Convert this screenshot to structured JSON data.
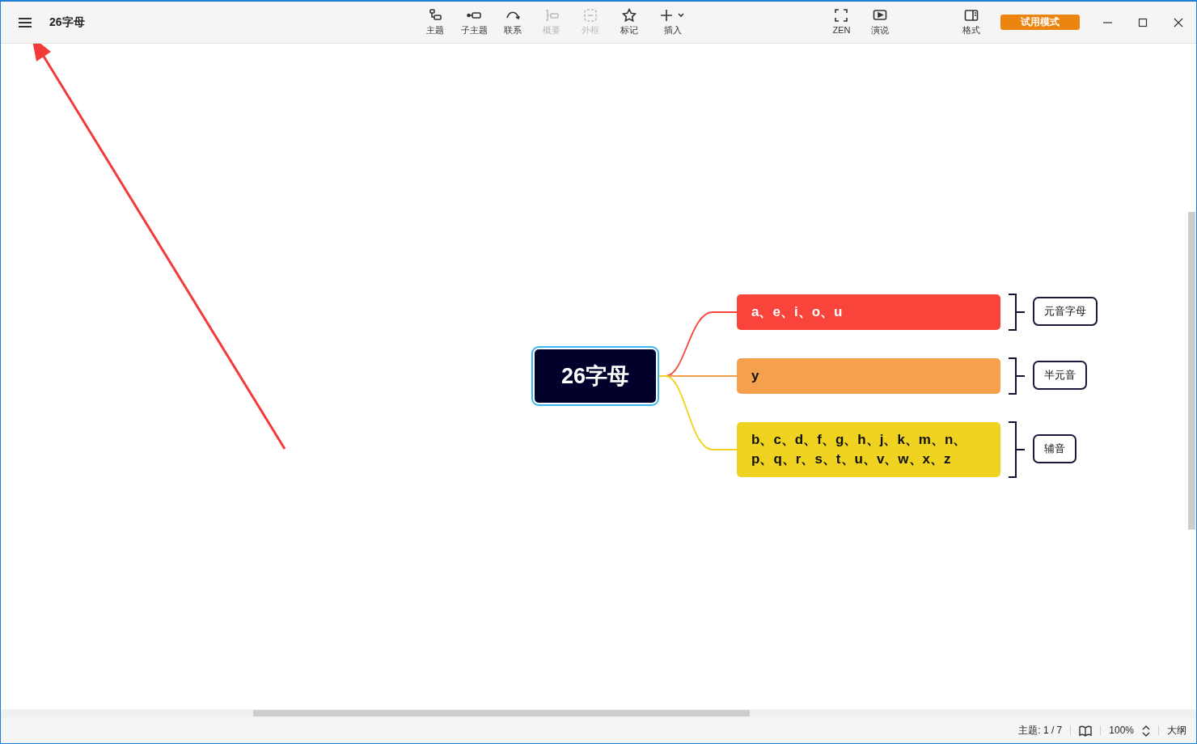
{
  "window": {
    "title": "26字母"
  },
  "toolbar": {
    "tools": [
      {
        "kind": "topic",
        "label": "主题",
        "disabled": false
      },
      {
        "kind": "subtopic",
        "label": "子主题",
        "disabled": false
      },
      {
        "kind": "relation",
        "label": "联系",
        "disabled": false
      },
      {
        "kind": "summary",
        "label": "概要",
        "disabled": true
      },
      {
        "kind": "boundary",
        "label": "外框",
        "disabled": true
      },
      {
        "kind": "marker",
        "label": "标记",
        "disabled": false
      },
      {
        "kind": "insert",
        "label": "插入",
        "disabled": false
      }
    ],
    "view_tools": [
      {
        "kind": "zen",
        "label": "ZEN"
      },
      {
        "kind": "present",
        "label": "演说"
      }
    ],
    "format": {
      "label": "格式"
    },
    "trial_button": "试用模式"
  },
  "mindmap": {
    "central": {
      "text": "26字母",
      "selected": true
    },
    "branches": [
      {
        "text": "a、e、i、o、u",
        "color": "#f9443c",
        "summary": "元音字母"
      },
      {
        "text": "y",
        "color": "#f5a04c",
        "summary": "半元音"
      },
      {
        "text": "b、c、d、f、g、h、j、k、m、n、p、q、r、s、t、u、v、w、x、z",
        "color": "#f0d321",
        "summary": "辅音"
      }
    ]
  },
  "status_bar": {
    "topic_count": "主题: 1 / 7",
    "zoom": "100%",
    "outline": "大纲"
  }
}
